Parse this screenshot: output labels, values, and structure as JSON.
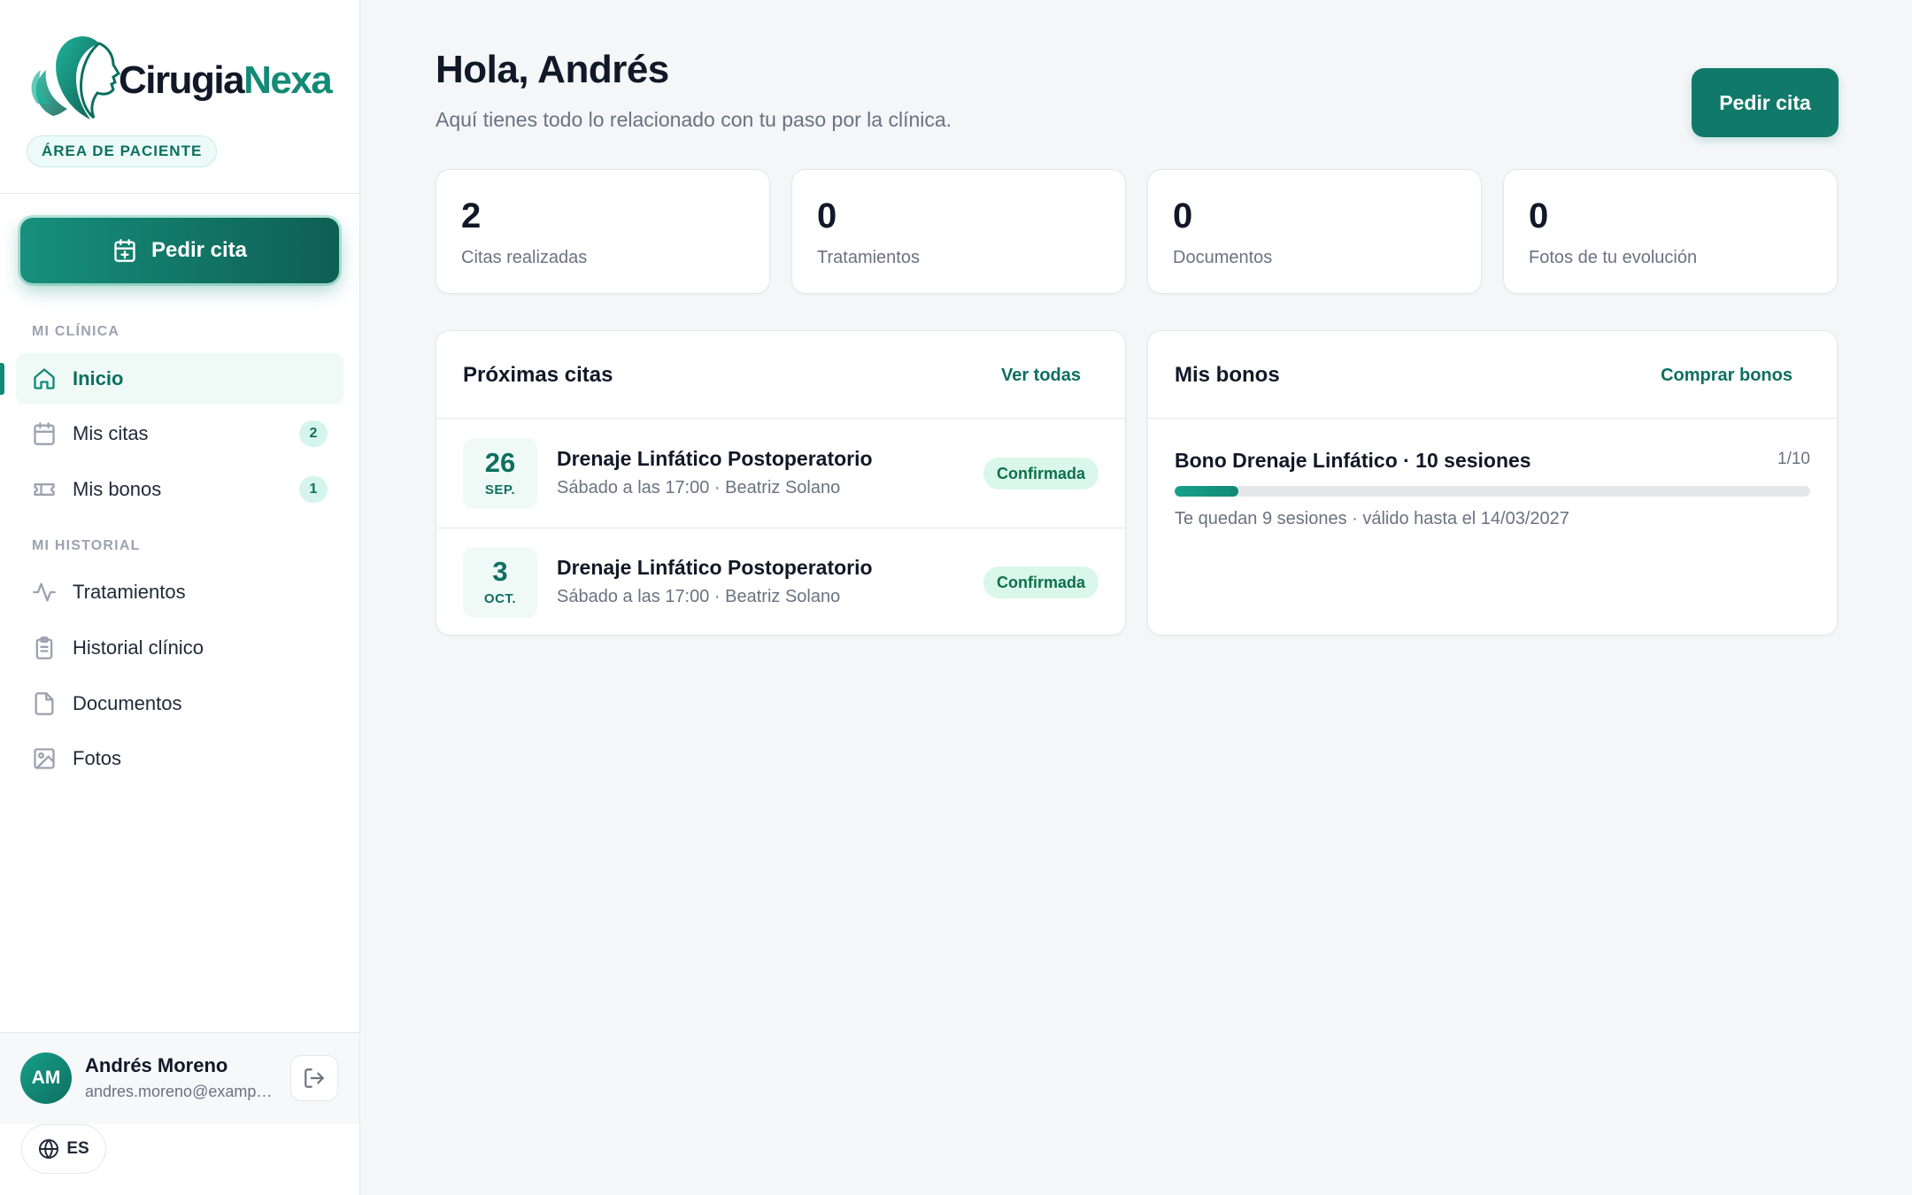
{
  "brand": {
    "name_part1": "Cirugia",
    "name_part2": "Nexa",
    "area_label": "ÁREA DE PACIENTE"
  },
  "sidebar": {
    "cta_label": "Pedir cita",
    "section_clinic": "MI CLÍNICA",
    "section_history": "MI HISTORIAL",
    "items": [
      {
        "label": "Inicio",
        "icon": "home-icon",
        "active": true
      },
      {
        "label": "Mis citas",
        "icon": "calendar-icon",
        "count": "2"
      },
      {
        "label": "Mis bonos",
        "icon": "ticket-icon",
        "count": "1"
      },
      {
        "label": "Tratamientos",
        "icon": "activity-icon"
      },
      {
        "label": "Historial clínico",
        "icon": "clipboard-icon"
      },
      {
        "label": "Documentos",
        "icon": "file-icon"
      },
      {
        "label": "Fotos",
        "icon": "image-icon"
      }
    ]
  },
  "user": {
    "initials": "AM",
    "name": "Andrés Moreno",
    "email": "andres.moreno@example.com",
    "language": "ES"
  },
  "header": {
    "title": "Hola, Andrés",
    "subtitle": "Aquí tienes todo lo relacionado con tu paso por la clínica.",
    "cta_label": "Pedir cita"
  },
  "stats": [
    {
      "value": "2",
      "label": "Citas realizadas"
    },
    {
      "value": "0",
      "label": "Tratamientos"
    },
    {
      "value": "0",
      "label": "Documentos"
    },
    {
      "value": "0",
      "label": "Fotos de tu evolución"
    }
  ],
  "appointments_panel": {
    "title": "Próximas citas",
    "link_label": "Ver todas",
    "items": [
      {
        "day": "26",
        "month": "SEP.",
        "title": "Drenaje Linfático Postoperatorio",
        "subtitle": "Sábado a las 17:00 · Beatriz Solano",
        "status": "Confirmada"
      },
      {
        "day": "3",
        "month": "OCT.",
        "title": "Drenaje Linfático Postoperatorio",
        "subtitle": "Sábado a las 17:00 · Beatriz Solano",
        "status": "Confirmada"
      }
    ]
  },
  "bonos_panel": {
    "title": "Mis bonos",
    "link_label": "Comprar bonos",
    "items": [
      {
        "name": "Bono Drenaje Linfático · 10 sesiones",
        "count": "1/10",
        "progress": 0.1,
        "subtitle": "Te quedan 9 sesiones · válido hasta el 14/03/2027"
      }
    ]
  },
  "colors": {
    "accent": "#128a76",
    "accent_dark": "#0e6f60",
    "badge_bg": "#d9f7ea"
  }
}
